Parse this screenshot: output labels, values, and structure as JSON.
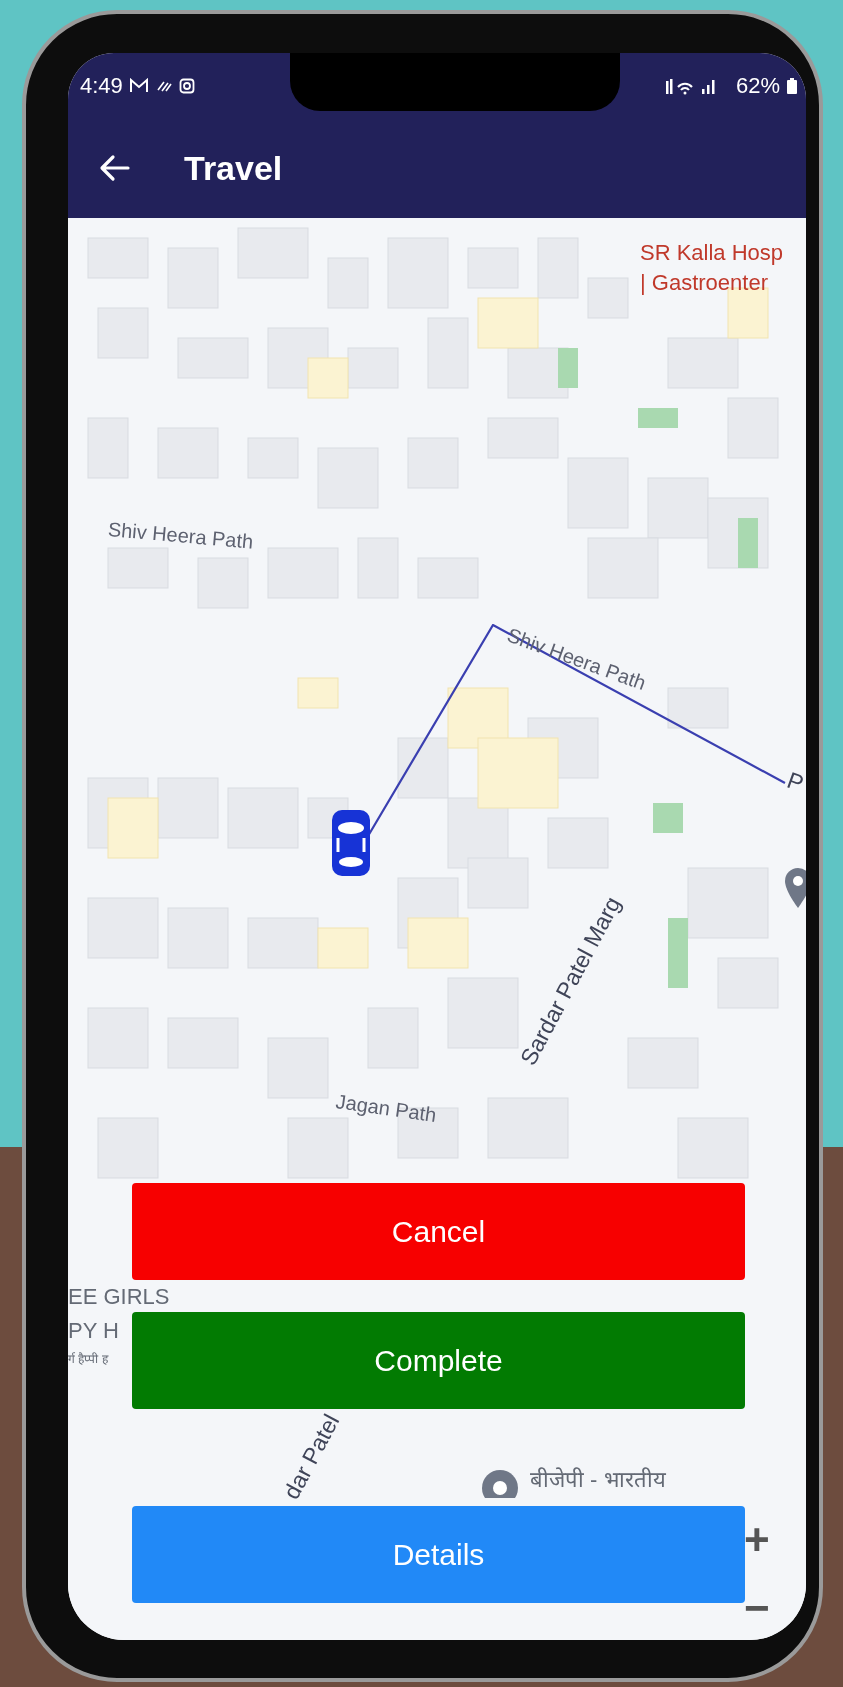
{
  "status_bar": {
    "time": "4:49",
    "battery": "62%"
  },
  "app_bar": {
    "title": "Travel"
  },
  "map": {
    "labels": [
      {
        "text": "SR Kalla Hosp",
        "kind": "poi"
      },
      {
        "text": "| Gastroenter",
        "kind": "poi"
      },
      {
        "text": "Shiv Heera Path",
        "kind": "street"
      },
      {
        "text": "Shiv Heera Path",
        "kind": "street"
      },
      {
        "text": "P",
        "kind": "road"
      },
      {
        "text": "Sardar Patel Marg",
        "kind": "road"
      },
      {
        "text": "Jagan Path",
        "kind": "street"
      },
      {
        "text": "EE GIRLS",
        "kind": "place"
      },
      {
        "text": "PY H",
        "kind": "place"
      },
      {
        "text": "र्ग हैप्पी ह",
        "kind": "small"
      },
      {
        "text": "dar Patel",
        "kind": "road"
      },
      {
        "text": "बीजेपी - भारतीय",
        "kind": "place"
      }
    ],
    "zoom_controls": [
      "+",
      "−"
    ]
  },
  "buttons": [
    {
      "label": "Cancel",
      "kind": "danger"
    },
    {
      "label": "Complete",
      "kind": "success"
    },
    {
      "label": "Details",
      "kind": "info"
    }
  ]
}
